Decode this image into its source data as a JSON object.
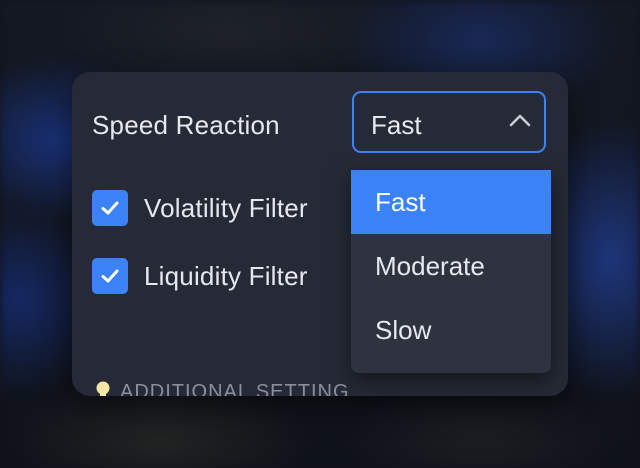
{
  "settings": {
    "speed_reaction": {
      "label": "Speed Reaction",
      "selected": "Fast",
      "options": [
        "Fast",
        "Moderate",
        "Slow"
      ]
    },
    "volatility_filter": {
      "label": "Volatility Filter",
      "checked": true
    },
    "liquidity_filter": {
      "label": "Liquidity Filter",
      "checked": true
    },
    "additional_setting": {
      "label": "ADDITIONAL SETTING",
      "icon": "lightbulb-icon"
    }
  },
  "colors": {
    "accent": "#3b82f6",
    "panel": "#262a36",
    "dropdown": "#2f3340",
    "text": "#e6e8ee",
    "muted": "#8b8f9c"
  }
}
